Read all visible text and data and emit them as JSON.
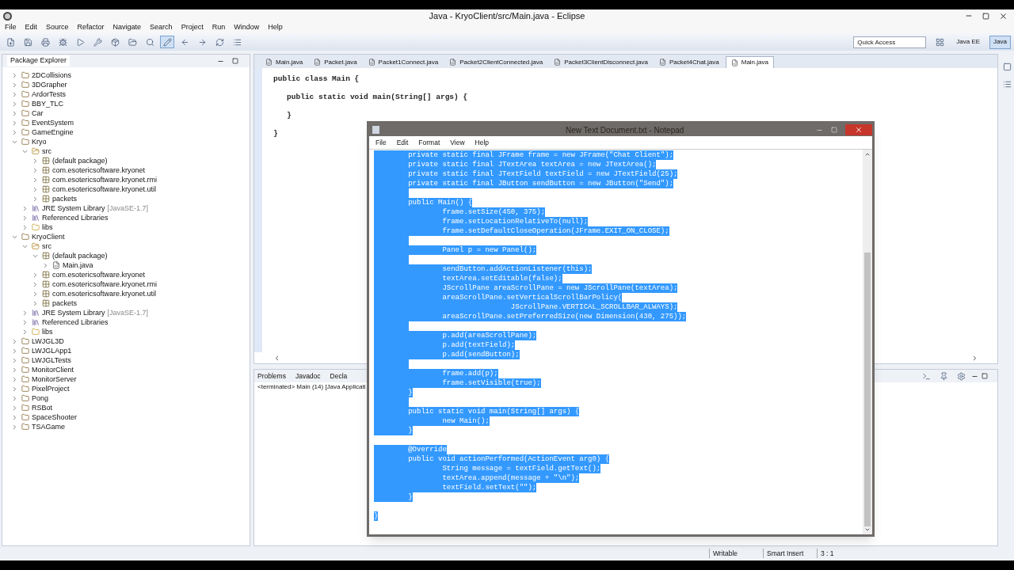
{
  "window": {
    "title": "Java - KryoClient/src/Main.java - Eclipse"
  },
  "menu": [
    "File",
    "Edit",
    "Source",
    "Refactor",
    "Navigate",
    "Search",
    "Project",
    "Run",
    "Window",
    "Help"
  ],
  "quick_access": {
    "placeholder": "Quick Access"
  },
  "perspectives": [
    {
      "label": "Java EE",
      "selected": false
    },
    {
      "label": "Java",
      "selected": true
    }
  ],
  "package_explorer": {
    "title": "Package Explorer",
    "tree": [
      {
        "label": "2DCollisions",
        "kind": "project",
        "expanded": false
      },
      {
        "label": "3DGrapher",
        "kind": "project",
        "expanded": false
      },
      {
        "label": "ArdorTests",
        "kind": "project",
        "expanded": false
      },
      {
        "label": "BBY_TLC",
        "kind": "project",
        "expanded": false
      },
      {
        "label": "Car",
        "kind": "project",
        "expanded": false
      },
      {
        "label": "EventSystem",
        "kind": "project",
        "expanded": false
      },
      {
        "label": "GameEngine",
        "kind": "project",
        "expanded": false
      },
      {
        "label": "Kryo",
        "kind": "project",
        "expanded": true,
        "children": [
          {
            "label": "src",
            "kind": "source",
            "expanded": true,
            "children": [
              {
                "label": "(default package)",
                "kind": "package",
                "expanded": false
              },
              {
                "label": "com.esotericsoftware.kryonet",
                "kind": "package",
                "expanded": false
              },
              {
                "label": "com.esotericsoftware.kryonet.rmi",
                "kind": "package",
                "expanded": false
              },
              {
                "label": "com.esotericsoftware.kryonet.util",
                "kind": "package",
                "expanded": false
              },
              {
                "label": "packets",
                "kind": "package",
                "expanded": false
              }
            ]
          },
          {
            "label": "JRE System Library",
            "detail": "[JavaSE-1.7]",
            "kind": "library",
            "expanded": false
          },
          {
            "label": "Referenced Libraries",
            "kind": "library",
            "expanded": false
          },
          {
            "label": "libs",
            "kind": "folder",
            "expanded": false
          }
        ]
      },
      {
        "label": "KryoClient",
        "kind": "project",
        "expanded": true,
        "children": [
          {
            "label": "src",
            "kind": "source",
            "expanded": true,
            "children": [
              {
                "label": "(default package)",
                "kind": "package",
                "expanded": true,
                "children": [
                  {
                    "label": "Main.java",
                    "kind": "file",
                    "expanded": false
                  }
                ]
              },
              {
                "label": "com.esotericsoftware.kryonet",
                "kind": "package",
                "expanded": false
              },
              {
                "label": "com.esotericsoftware.kryonet.rmi",
                "kind": "package",
                "expanded": false
              },
              {
                "label": "com.esotericsoftware.kryonet.util",
                "kind": "package",
                "expanded": false
              },
              {
                "label": "packets",
                "kind": "package",
                "expanded": false
              }
            ]
          },
          {
            "label": "JRE System Library",
            "detail": "[JavaSE-1.7]",
            "kind": "library",
            "expanded": false
          },
          {
            "label": "Referenced Libraries",
            "kind": "library",
            "expanded": false
          },
          {
            "label": "libs",
            "kind": "folder",
            "expanded": false
          }
        ]
      },
      {
        "label": "LWJGL3D",
        "kind": "project",
        "expanded": false
      },
      {
        "label": "LWJGLApp1",
        "kind": "project",
        "expanded": false
      },
      {
        "label": "LWJGLTests",
        "kind": "project",
        "expanded": false
      },
      {
        "label": "MonitorClient",
        "kind": "project",
        "expanded": false
      },
      {
        "label": "MonitorServer",
        "kind": "project",
        "expanded": false
      },
      {
        "label": "PixelProject",
        "kind": "project",
        "expanded": false
      },
      {
        "label": "Pong",
        "kind": "project",
        "expanded": false
      },
      {
        "label": "RSBot",
        "kind": "project",
        "expanded": false
      },
      {
        "label": "SpaceShooter",
        "kind": "project",
        "expanded": false
      },
      {
        "label": "TSAGame",
        "kind": "project",
        "expanded": false
      }
    ]
  },
  "editor_tabs": [
    {
      "label": "Main.java",
      "selected": false
    },
    {
      "label": "Packet.java",
      "selected": false
    },
    {
      "label": "Packet1Connect.java",
      "selected": false
    },
    {
      "label": "Packet2ClientConnected.java",
      "selected": false
    },
    {
      "label": "Packet3ClientDisconnect.java",
      "selected": false
    },
    {
      "label": "Packet4Chat.java",
      "selected": false
    },
    {
      "label": "Main.java",
      "selected": true
    }
  ],
  "editor_lines": [
    "public class Main {",
    "\tpublic static void main(String[] args) {",
    "\t}",
    "}"
  ],
  "bottom_tabs": [
    {
      "label": "Problems",
      "selected": false
    },
    {
      "label": "Javadoc",
      "selected": false
    },
    {
      "label": "Decla",
      "selected": false
    }
  ],
  "console_line": "<terminated> Main (14) [Java Applicati",
  "status_bar": [
    "Writable",
    "Smart Insert",
    "3 : 1"
  ],
  "notepad": {
    "title": "New Text Document.txt - Notepad",
    "menu": [
      "File",
      "Edit",
      "Format",
      "View",
      "Help"
    ],
    "lines": [
      {
        "kind": "code",
        "text": "\tprivate static final JFrame frame = new JFrame(\"Chat Client\");",
        "selected": true
      },
      {
        "kind": "code",
        "text": "\tprivate static final JTextArea textArea = new JTextArea();",
        "selected": true
      },
      {
        "kind": "code",
        "text": "\tprivate static final JTextField textField = new JTextField(25);",
        "selected": true
      },
      {
        "kind": "code",
        "text": "\tprivate static final JButton sendButton = new JButton(\"Send\");",
        "selected": true
      },
      {
        "kind": "blank",
        "selected": true
      },
      {
        "kind": "code",
        "text": "\tpublic Main() {",
        "selected": true
      },
      {
        "kind": "code",
        "text": "\t\tframe.setSize(450, 375);",
        "selected": true
      },
      {
        "kind": "code",
        "text": "\t\tframe.setLocationRelativeTo(null);",
        "selected": true
      },
      {
        "kind": "code",
        "text": "\t\tframe.setDefaultCloseOperation(JFrame.EXIT_ON_CLOSE);",
        "selected": true
      },
      {
        "kind": "blank",
        "selected": true
      },
      {
        "kind": "code",
        "text": "\t\tPanel p = new Panel();",
        "selected": true
      },
      {
        "kind": "blank",
        "selected": true
      },
      {
        "kind": "code",
        "text": "\t\tsendButton.addActionListener(this);",
        "selected": true
      },
      {
        "kind": "code",
        "text": "\t\ttextArea.setEditable(false);",
        "selected": true
      },
      {
        "kind": "code",
        "text": "\t\tJScrollPane areaScrollPane = new JScrollPane(textArea);",
        "selected": true
      },
      {
        "kind": "code",
        "text": "\t\tareaScrollPane.setVerticalScrollBarPolicy(",
        "selected": true
      },
      {
        "kind": "code",
        "text": "\t\t\t\tJScrollPane.VERTICAL_SCROLLBAR_ALWAYS);",
        "selected": true
      },
      {
        "kind": "code",
        "text": "\t\tareaScrollPane.setPreferredSize(new Dimension(430, 275));",
        "selected": true
      },
      {
        "kind": "blank",
        "selected": true
      },
      {
        "kind": "code",
        "text": "\t\tp.add(areaScrollPane);",
        "selected": true
      },
      {
        "kind": "code",
        "text": "\t\tp.add(textField);",
        "selected": true
      },
      {
        "kind": "code",
        "text": "\t\tp.add(sendButton);",
        "selected": true
      },
      {
        "kind": "blank",
        "selected": true
      },
      {
        "kind": "code",
        "text": "\t\tframe.add(p);",
        "selected": true
      },
      {
        "kind": "code",
        "text": "\t\tframe.setVisible(true);",
        "selected": true
      },
      {
        "kind": "code",
        "text": "\t}",
        "selected": true
      },
      {
        "kind": "blank",
        "selected": true
      },
      {
        "kind": "code",
        "text": "\tpublic static void main(String[] args) {",
        "selected": true
      },
      {
        "kind": "code",
        "text": "\t\tnew Main();",
        "selected": true
      },
      {
        "kind": "code",
        "text": "\t}",
        "selected": true
      },
      {
        "kind": "blank",
        "selected": false
      },
      {
        "kind": "code",
        "text": "\t@Override",
        "selected": true
      },
      {
        "kind": "code",
        "text": "\tpublic void actionPerformed(ActionEvent arg0) {",
        "selected": true
      },
      {
        "kind": "code",
        "text": "\t\tString message = textField.getText();",
        "selected": true
      },
      {
        "kind": "code",
        "text": "\t\ttextArea.append(message + \"\\n\");",
        "selected": true
      },
      {
        "kind": "code",
        "text": "\t\ttextField.setText(\"\");",
        "selected": true
      },
      {
        "kind": "code",
        "text": "\t}",
        "selected": true
      },
      {
        "kind": "blank",
        "selected": false
      },
      {
        "kind": "code",
        "text": "}",
        "selected": true
      }
    ]
  }
}
